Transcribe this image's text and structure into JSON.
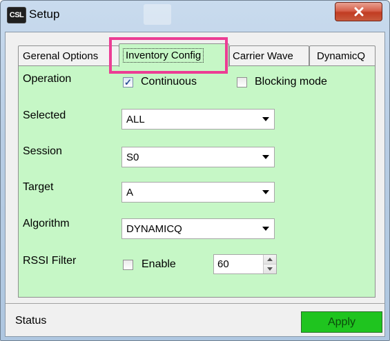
{
  "window": {
    "title": "Setup",
    "icon_text": "CSL",
    "close_icon": "close-icon"
  },
  "tabs": [
    {
      "label": "Gerenal Options"
    },
    {
      "label": "Inventory Config",
      "active": true
    },
    {
      "label": "Carrier Wave"
    },
    {
      "label": "DynamicQ"
    }
  ],
  "form": {
    "operation": {
      "label": "Operation",
      "continuous_label": "Continuous",
      "continuous_checked": true,
      "blocking_label": "Blocking mode",
      "blocking_checked": false
    },
    "selected": {
      "label": "Selected",
      "value": "ALL"
    },
    "session": {
      "label": "Session",
      "value": "S0"
    },
    "target": {
      "label": "Target",
      "value": "A"
    },
    "algorithm": {
      "label": "Algorithm",
      "value": "DYNAMICQ"
    },
    "rssi_filter": {
      "label": "RSSI Filter",
      "enable_label": "Enable",
      "enable_checked": false,
      "value": "60"
    }
  },
  "status_bar": {
    "status_label": "Status",
    "apply_label": "Apply"
  },
  "colors": {
    "panel_bg": "#c6f7c6",
    "highlight": "#ec3d94",
    "apply_bg": "#1fc41f"
  }
}
